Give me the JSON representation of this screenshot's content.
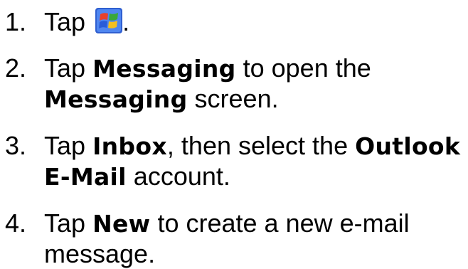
{
  "steps": [
    {
      "number": "1.",
      "text_before": "Tap",
      "icon": "windows-start-icon",
      "text_after": "."
    },
    {
      "number": "2.",
      "tap": "Tap",
      "term1": "Messaging",
      "middle": "to open the",
      "term2": "Messaging",
      "end": "screen."
    },
    {
      "number": "3.",
      "tap": "Tap",
      "term1": "Inbox",
      "middle": ", then select the",
      "term2": "Outlook E-Mail",
      "end": "account."
    },
    {
      "number": "4.",
      "tap": "Tap",
      "term1": "New",
      "end": "to create a new e-mail message."
    }
  ],
  "colors": {
    "text": "#000000",
    "background": "#ffffff",
    "icon_blue": "#2f5fd0",
    "icon_red": "#e8402a",
    "icon_green": "#3aa83a",
    "icon_yellow": "#f4c020"
  }
}
